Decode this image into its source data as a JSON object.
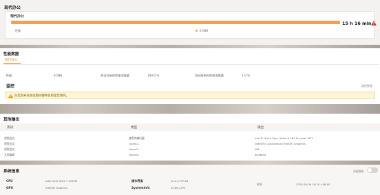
{
  "workload": {
    "section_title": "现代办公",
    "card_title": "现代办公",
    "progress": 1.0,
    "score_label": "性能",
    "score_value": "6 088",
    "duration": "15 h 16 min",
    "bar_color": "#f0a158"
  },
  "perf": {
    "title": "性能数据",
    "tab": "现代办公",
    "score_label": "性能",
    "score_value": "6 088",
    "start_label": "测试开始时的电池电量",
    "start_value": "100.0 %",
    "end_label": "测试结束时的电池电量",
    "end_value": "1.0 %",
    "monitor_title": "监控",
    "monitor_link": "监控数据",
    "alert_text": "在电池寿命测试期间硬件监控是禁用的。",
    "accent": "#e0872e"
  },
  "other": {
    "title": "其他输出",
    "headers": [
      "测试",
      "类型",
      "输出"
    ],
    "rows": [
      [
        "视频会议",
        "使用的编码器",
        "Intel® Quick Sync Video H.264 Encoder MFT"
      ],
      [
        "视频会议",
        "OpenCL",
        "[Intel(R) Corporation] Intel(R) Graphics"
      ],
      [
        "视频会议",
        "OpenCL",
        "N/A"
      ],
      [
        "文档编辑",
        "OpenGL",
        "disabled"
      ]
    ]
  },
  "sysinfo": {
    "title": "系统信息",
    "advanced_label": "高级数据",
    "cpu_label": "CPU",
    "cpu_value": "Intel Core Ultra 7 255HX",
    "gpu_label": "GPU",
    "gpu_value": "Intel(R) Graphics",
    "os_label": "操作界面",
    "os_value": "v2.2.2737.64",
    "si_label": "SystemInfo",
    "si_value": "v5.86.1375",
    "time_label": "时间",
    "time_value": "2025-09-06 16:20 +08:00"
  },
  "icons": [
    "warning-icon",
    "toggle-switch"
  ]
}
